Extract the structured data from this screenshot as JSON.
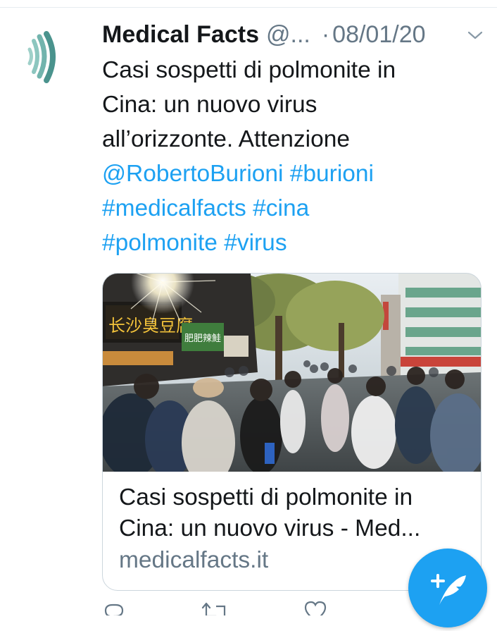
{
  "tweet": {
    "author_name": "Medical Facts",
    "author_handle": "@...",
    "separator": "·",
    "date": "08/01/20",
    "text_lines": [
      "Casi sospetti di polmonite in",
      "Cina: un nuovo virus",
      "all’orizzonte. Attenzione"
    ],
    "mention": "@RobertoBurioni",
    "hashtags": {
      "burioni": "#burioni",
      "medicalfacts": "#medicalfacts",
      "cina": "#cina",
      "polmonite": "#polmonite",
      "virus": "#virus"
    }
  },
  "card": {
    "title_line1": "Casi sospetti di polmonite in",
    "title_line2": "Cina: un nuovo virus - Med...",
    "domain": "medicalfacts.it",
    "image_sign_text": "长沙臭豆腐",
    "image_sign_text_2": "肥肥辣鮭"
  },
  "colors": {
    "link": "#1da1f2",
    "secondary_text": "#657786",
    "avatar_waves": "#5aa39c",
    "fab": "#1da1f2"
  },
  "icons": {
    "avatar": "sound-waves-logo",
    "caret": "chevron-down-icon",
    "fab": "compose-tweet-icon",
    "reply": "reply-icon",
    "retweet": "retweet-icon",
    "like": "heart-icon",
    "share": "share-icon"
  }
}
